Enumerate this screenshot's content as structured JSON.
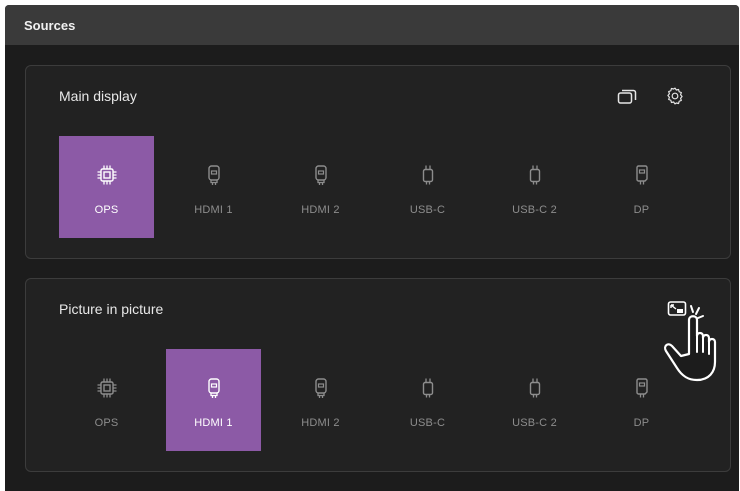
{
  "header": {
    "title": "Sources"
  },
  "main_display": {
    "title": "Main display",
    "tools": [
      {
        "name": "multi-window-icon"
      },
      {
        "name": "settings-gear-icon"
      }
    ],
    "sources": [
      {
        "label": "OPS",
        "icon": "chip-icon",
        "active": true
      },
      {
        "label": "HDMI 1",
        "icon": "hdmi-icon",
        "active": false
      },
      {
        "label": "HDMI 2",
        "icon": "hdmi-icon",
        "active": false
      },
      {
        "label": "USB-C",
        "icon": "usb-c-icon",
        "active": false
      },
      {
        "label": "USB-C 2",
        "icon": "usb-c-icon",
        "active": false
      },
      {
        "label": "DP",
        "icon": "displayport-icon",
        "active": false
      }
    ]
  },
  "picture_in_picture": {
    "title": "Picture in picture",
    "tools": [
      {
        "name": "picture-in-picture-icon"
      }
    ],
    "sources": [
      {
        "label": "OPS",
        "icon": "chip-icon",
        "active": false
      },
      {
        "label": "HDMI 1",
        "icon": "hdmi-icon",
        "active": true
      },
      {
        "label": "HDMI 2",
        "icon": "hdmi-icon",
        "active": false
      },
      {
        "label": "USB-C",
        "icon": "usb-c-icon",
        "active": false
      },
      {
        "label": "USB-C 2",
        "icon": "usb-c-icon",
        "active": false
      },
      {
        "label": "DP",
        "icon": "displayport-icon",
        "active": false
      }
    ]
  },
  "colors": {
    "active_tile": "#8c5aa6",
    "background": "#1c1c1c",
    "panel": "#222222",
    "header": "#3a3a3a"
  }
}
